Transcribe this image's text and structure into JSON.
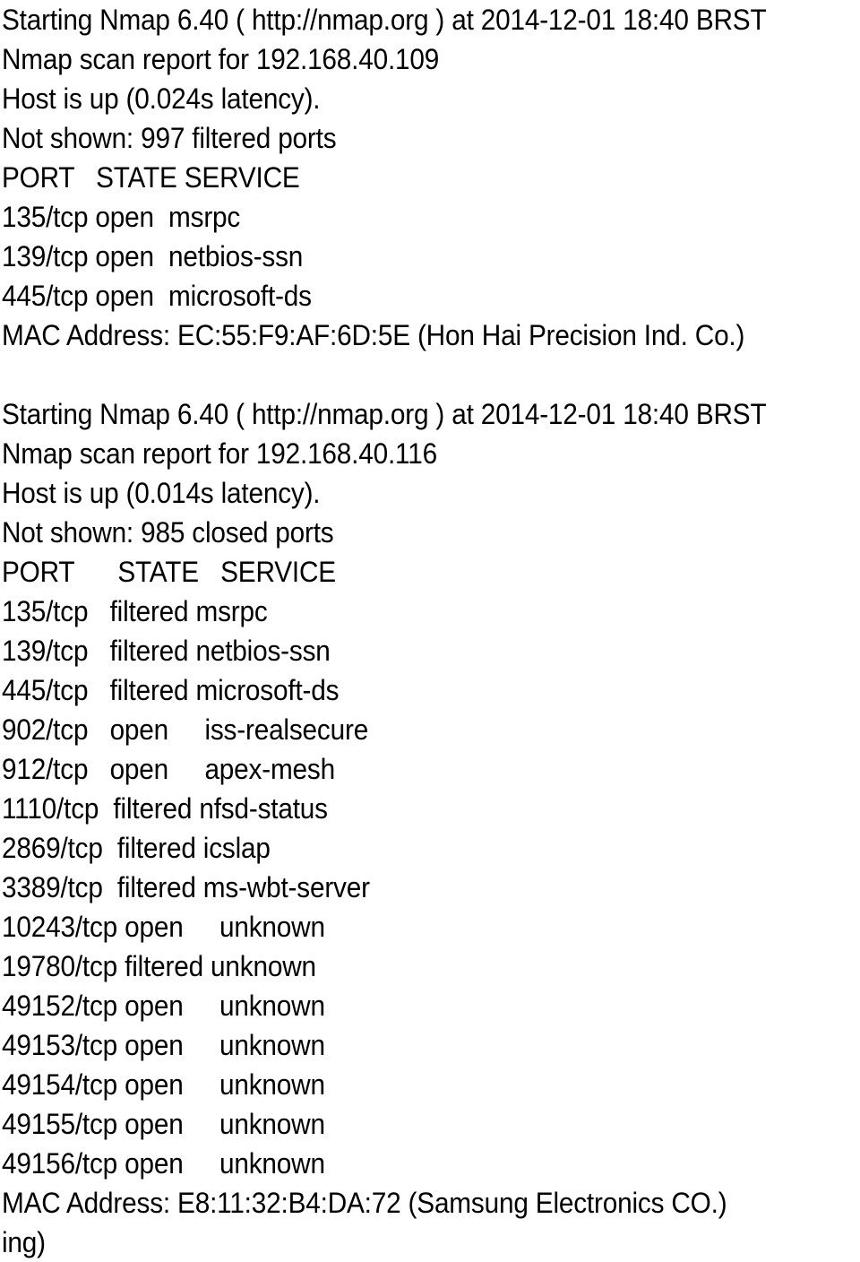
{
  "document": {
    "kind": "nmap-scan-output",
    "text_color": "#000000",
    "background_color": "#ffffff",
    "reports": [
      {
        "id": "report-192-168-40-109",
        "banner": "Starting Nmap 6.40 ( http://nmap.org ) at 2014-12-01 18:40 BRST",
        "nmap_version": "6.40",
        "nmap_url": "http://nmap.org",
        "scan_date": "2014-12-01",
        "scan_time": "18:40",
        "timezone": "BRST",
        "scan_report_line": "Nmap scan report for 192.168.40.109",
        "target_ip": "192.168.40.109",
        "host_status_line": "Host is up (0.024s latency).",
        "latency": "0.024s",
        "not_shown_line": "Not shown: 997 filtered ports",
        "not_shown_count": "997",
        "not_shown_state": "filtered",
        "table_header_line": "PORT   STATE SERVICE",
        "columns": [
          "PORT",
          "STATE",
          "SERVICE"
        ],
        "ports": [
          {
            "line": "135/tcp open  msrpc",
            "port": "135/tcp",
            "state": "open",
            "service": "msrpc"
          },
          {
            "line": "139/tcp open  netbios-ssn",
            "port": "139/tcp",
            "state": "open",
            "service": "netbios-ssn"
          },
          {
            "line": "445/tcp open  microsoft-ds",
            "port": "445/tcp",
            "state": "open",
            "service": "microsoft-ds"
          }
        ],
        "mac_line": "MAC Address: EC:55:F9:AF:6D:5E (Hon Hai Precision Ind. Co.)",
        "mac_address": "EC:55:F9:AF:6D:5E",
        "mac_vendor": "Hon Hai Precision Ind. Co."
      },
      {
        "id": "report-192-168-40-116",
        "banner": "Starting Nmap 6.40 ( http://nmap.org ) at 2014-12-01 18:40 BRST",
        "nmap_version": "6.40",
        "nmap_url": "http://nmap.org",
        "scan_date": "2014-12-01",
        "scan_time": "18:40",
        "timezone": "BRST",
        "scan_report_line": "Nmap scan report for 192.168.40.116",
        "target_ip": "192.168.40.116",
        "host_status_line": "Host is up (0.014s latency).",
        "latency": "0.014s",
        "not_shown_line": "Not shown: 985 closed ports",
        "not_shown_count": "985",
        "not_shown_state": "closed",
        "table_header_line": "PORT      STATE   SERVICE",
        "columns": [
          "PORT",
          "STATE",
          "SERVICE"
        ],
        "ports": [
          {
            "line": "135/tcp   filtered msrpc",
            "port": "135/tcp",
            "state": "filtered",
            "service": "msrpc"
          },
          {
            "line": "139/tcp   filtered netbios-ssn",
            "port": "139/tcp",
            "state": "filtered",
            "service": "netbios-ssn"
          },
          {
            "line": "445/tcp   filtered microsoft-ds",
            "port": "445/tcp",
            "state": "filtered",
            "service": "microsoft-ds"
          },
          {
            "line": "902/tcp   open     iss-realsecure",
            "port": "902/tcp",
            "state": "open",
            "service": "iss-realsecure"
          },
          {
            "line": "912/tcp   open     apex-mesh",
            "port": "912/tcp",
            "state": "open",
            "service": "apex-mesh"
          },
          {
            "line": "1110/tcp  filtered nfsd-status",
            "port": "1110/tcp",
            "state": "filtered",
            "service": "nfsd-status"
          },
          {
            "line": "2869/tcp  filtered icslap",
            "port": "2869/tcp",
            "state": "filtered",
            "service": "icslap"
          },
          {
            "line": "3389/tcp  filtered ms-wbt-server",
            "port": "3389/tcp",
            "state": "filtered",
            "service": "ms-wbt-server"
          },
          {
            "line": "10243/tcp open     unknown",
            "port": "10243/tcp",
            "state": "open",
            "service": "unknown"
          },
          {
            "line": "19780/tcp filtered unknown",
            "port": "19780/tcp",
            "state": "filtered",
            "service": "unknown"
          },
          {
            "line": "49152/tcp open     unknown",
            "port": "49152/tcp",
            "state": "open",
            "service": "unknown"
          },
          {
            "line": "49153/tcp open     unknown",
            "port": "49153/tcp",
            "state": "open",
            "service": "unknown"
          },
          {
            "line": "49154/tcp open     unknown",
            "port": "49154/tcp",
            "state": "open",
            "service": "unknown"
          },
          {
            "line": "49155/tcp open     unknown",
            "port": "49155/tcp",
            "state": "open",
            "service": "unknown"
          },
          {
            "line": "49156/tcp open     unknown",
            "port": "49156/tcp",
            "state": "open",
            "service": "unknown"
          }
        ],
        "mac_line": "MAC Address: E8:11:32:B4:DA:72 (Samsung Electronics CO.)",
        "mac_address": "E8:11:32:B4:DA:72",
        "mac_vendor": "Samsung Electronics CO."
      }
    ],
    "trailing_fragment": "ing)"
  }
}
